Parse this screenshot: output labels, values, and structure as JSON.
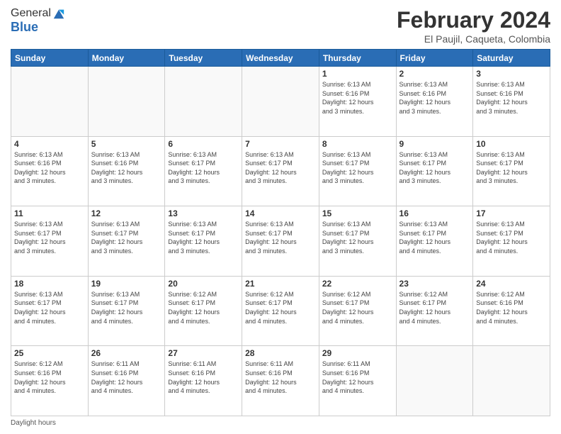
{
  "logo": {
    "line1": "General",
    "line2": "Blue"
  },
  "title": "February 2024",
  "subtitle": "El Paujil, Caqueta, Colombia",
  "days_header": [
    "Sunday",
    "Monday",
    "Tuesday",
    "Wednesday",
    "Thursday",
    "Friday",
    "Saturday"
  ],
  "footer": "Daylight hours",
  "weeks": [
    [
      {
        "day": "",
        "info": ""
      },
      {
        "day": "",
        "info": ""
      },
      {
        "day": "",
        "info": ""
      },
      {
        "day": "",
        "info": ""
      },
      {
        "day": "1",
        "info": "Sunrise: 6:13 AM\nSunset: 6:16 PM\nDaylight: 12 hours\nand 3 minutes."
      },
      {
        "day": "2",
        "info": "Sunrise: 6:13 AM\nSunset: 6:16 PM\nDaylight: 12 hours\nand 3 minutes."
      },
      {
        "day": "3",
        "info": "Sunrise: 6:13 AM\nSunset: 6:16 PM\nDaylight: 12 hours\nand 3 minutes."
      }
    ],
    [
      {
        "day": "4",
        "info": "Sunrise: 6:13 AM\nSunset: 6:16 PM\nDaylight: 12 hours\nand 3 minutes."
      },
      {
        "day": "5",
        "info": "Sunrise: 6:13 AM\nSunset: 6:16 PM\nDaylight: 12 hours\nand 3 minutes."
      },
      {
        "day": "6",
        "info": "Sunrise: 6:13 AM\nSunset: 6:17 PM\nDaylight: 12 hours\nand 3 minutes."
      },
      {
        "day": "7",
        "info": "Sunrise: 6:13 AM\nSunset: 6:17 PM\nDaylight: 12 hours\nand 3 minutes."
      },
      {
        "day": "8",
        "info": "Sunrise: 6:13 AM\nSunset: 6:17 PM\nDaylight: 12 hours\nand 3 minutes."
      },
      {
        "day": "9",
        "info": "Sunrise: 6:13 AM\nSunset: 6:17 PM\nDaylight: 12 hours\nand 3 minutes."
      },
      {
        "day": "10",
        "info": "Sunrise: 6:13 AM\nSunset: 6:17 PM\nDaylight: 12 hours\nand 3 minutes."
      }
    ],
    [
      {
        "day": "11",
        "info": "Sunrise: 6:13 AM\nSunset: 6:17 PM\nDaylight: 12 hours\nand 3 minutes."
      },
      {
        "day": "12",
        "info": "Sunrise: 6:13 AM\nSunset: 6:17 PM\nDaylight: 12 hours\nand 3 minutes."
      },
      {
        "day": "13",
        "info": "Sunrise: 6:13 AM\nSunset: 6:17 PM\nDaylight: 12 hours\nand 3 minutes."
      },
      {
        "day": "14",
        "info": "Sunrise: 6:13 AM\nSunset: 6:17 PM\nDaylight: 12 hours\nand 3 minutes."
      },
      {
        "day": "15",
        "info": "Sunrise: 6:13 AM\nSunset: 6:17 PM\nDaylight: 12 hours\nand 3 minutes."
      },
      {
        "day": "16",
        "info": "Sunrise: 6:13 AM\nSunset: 6:17 PM\nDaylight: 12 hours\nand 4 minutes."
      },
      {
        "day": "17",
        "info": "Sunrise: 6:13 AM\nSunset: 6:17 PM\nDaylight: 12 hours\nand 4 minutes."
      }
    ],
    [
      {
        "day": "18",
        "info": "Sunrise: 6:13 AM\nSunset: 6:17 PM\nDaylight: 12 hours\nand 4 minutes."
      },
      {
        "day": "19",
        "info": "Sunrise: 6:13 AM\nSunset: 6:17 PM\nDaylight: 12 hours\nand 4 minutes."
      },
      {
        "day": "20",
        "info": "Sunrise: 6:12 AM\nSunset: 6:17 PM\nDaylight: 12 hours\nand 4 minutes."
      },
      {
        "day": "21",
        "info": "Sunrise: 6:12 AM\nSunset: 6:17 PM\nDaylight: 12 hours\nand 4 minutes."
      },
      {
        "day": "22",
        "info": "Sunrise: 6:12 AM\nSunset: 6:17 PM\nDaylight: 12 hours\nand 4 minutes."
      },
      {
        "day": "23",
        "info": "Sunrise: 6:12 AM\nSunset: 6:17 PM\nDaylight: 12 hours\nand 4 minutes."
      },
      {
        "day": "24",
        "info": "Sunrise: 6:12 AM\nSunset: 6:16 PM\nDaylight: 12 hours\nand 4 minutes."
      }
    ],
    [
      {
        "day": "25",
        "info": "Sunrise: 6:12 AM\nSunset: 6:16 PM\nDaylight: 12 hours\nand 4 minutes."
      },
      {
        "day": "26",
        "info": "Sunrise: 6:11 AM\nSunset: 6:16 PM\nDaylight: 12 hours\nand 4 minutes."
      },
      {
        "day": "27",
        "info": "Sunrise: 6:11 AM\nSunset: 6:16 PM\nDaylight: 12 hours\nand 4 minutes."
      },
      {
        "day": "28",
        "info": "Sunrise: 6:11 AM\nSunset: 6:16 PM\nDaylight: 12 hours\nand 4 minutes."
      },
      {
        "day": "29",
        "info": "Sunrise: 6:11 AM\nSunset: 6:16 PM\nDaylight: 12 hours\nand 4 minutes."
      },
      {
        "day": "",
        "info": ""
      },
      {
        "day": "",
        "info": ""
      }
    ]
  ]
}
